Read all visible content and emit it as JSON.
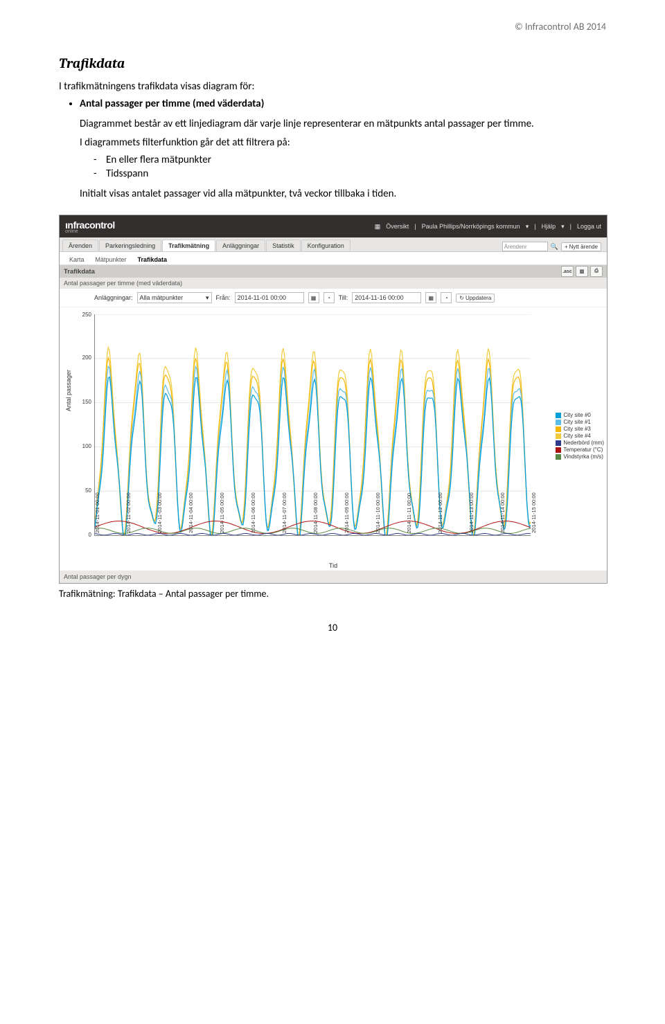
{
  "copyright": "© Infracontrol AB 2014",
  "heading": "Trafikdata",
  "intro": "I trafikmätningens trafikdata visas diagram för:",
  "bullet1_title": "Antal passager per timme (med väderdata)",
  "para1": "Diagrammet består av ett linjediagram där varje linje representerar en mätpunkts antal passager per timme.",
  "para2": "I diagrammets filterfunktion går det att filtrera på:",
  "dash1": "En eller flera mätpunkter",
  "dash2": "Tidsspann",
  "para3": "Initialt visas antalet passager vid alla mätpunkter, två veckor tillbaka i tiden.",
  "caption": "Trafikmätning: Trafikdata – Antal passager per timme.",
  "pagenum": "10",
  "ui": {
    "logo": "ınfracontrol",
    "logo_sub": "online",
    "top_oversikt": "Översikt",
    "top_user": "Paula Phillips/Norrköpings kommun",
    "top_help": "Hjälp",
    "top_logout": "Logga ut",
    "tabs": [
      "Ärenden",
      "Parkeringsledning",
      "Trafikmätning",
      "Anläggningar",
      "Statistik",
      "Konfiguration"
    ],
    "search_placeholder": "Ärendenr",
    "new_ticket": "Nytt ärende",
    "subtabs": [
      "Karta",
      "Mätpunkter",
      "Trafikdata"
    ],
    "section_title": "Trafikdata",
    "asc": ".asc",
    "chart_title": "Antal passager per timme (med väderdata)",
    "filt_anl": "Anläggningar:",
    "filt_anl_val": "Alla mätpunkter",
    "filt_from": "Från:",
    "filt_from_val": "2014-11-01 00:00",
    "filt_till": "Till:",
    "filt_till_val": "2014-11-16 00:00",
    "filt_upd": "Uppdatera",
    "ylabel": "Antal passager",
    "xlabel": "Tid",
    "footer": "Antal passager per dygn",
    "legend": [
      {
        "label": "City site #0",
        "color": "#009edb"
      },
      {
        "label": "City site #1",
        "color": "#5cbce8"
      },
      {
        "label": "City site #3",
        "color": "#f2b707"
      },
      {
        "label": "City site #4",
        "color": "#f2cb3a"
      },
      {
        "label": "Nederbörd (mm)",
        "color": "#2e3a8c"
      },
      {
        "label": "Temperatur (°C)",
        "color": "#b01111"
      },
      {
        "label": "Vindstyrka (m/s)",
        "color": "#5a8a45"
      }
    ],
    "yticks": [
      "0",
      "50",
      "100",
      "150",
      "200",
      "250"
    ],
    "xticks": [
      "2014-11-01 00:00",
      "2014-11-02 00:00",
      "2014-11-03 00:00",
      "2014-11-04 00:00",
      "2014-11-05 00:00",
      "2014-11-06 00:00",
      "2014-11-07 00:00",
      "2014-11-08 00:00",
      "2014-11-09 00:00",
      "2014-11-10 00:00",
      "2014-11-11 00:00",
      "2014-11-12 00:00",
      "2014-11-13 00:00",
      "2014-11-14 00:00",
      "2014-11-15 00:00"
    ]
  },
  "chart_data": {
    "type": "line",
    "title": "Antal passager per timme (med väderdata)",
    "xlabel": "Tid",
    "ylabel": "Antal passager",
    "ylim": [
      0,
      250
    ],
    "x_range": [
      "2014-11-01 00:00",
      "2014-11-16 00:00"
    ],
    "note": "Hourly diurnal traffic counts per site over ~15 days; values estimated from chart pixels.",
    "series": [
      {
        "name": "City site #0",
        "color": "#009edb",
        "approx_daily_min": 5,
        "approx_daily_max": 175
      },
      {
        "name": "City site #1",
        "color": "#5cbce8",
        "approx_daily_min": 5,
        "approx_daily_max": 190
      },
      {
        "name": "City site #3",
        "color": "#f2b707",
        "approx_daily_min": 5,
        "approx_daily_max": 200
      },
      {
        "name": "City site #4",
        "color": "#f2cb3a",
        "approx_daily_min": 5,
        "approx_daily_max": 210
      },
      {
        "name": "Nederbörd (mm)",
        "color": "#2e3a8c",
        "approx_range": [
          0,
          3
        ]
      },
      {
        "name": "Temperatur (°C)",
        "color": "#b01111",
        "approx_range": [
          0,
          12
        ]
      },
      {
        "name": "Vindstyrka (m/s)",
        "color": "#5a8a45",
        "approx_range": [
          0,
          8
        ]
      }
    ]
  }
}
